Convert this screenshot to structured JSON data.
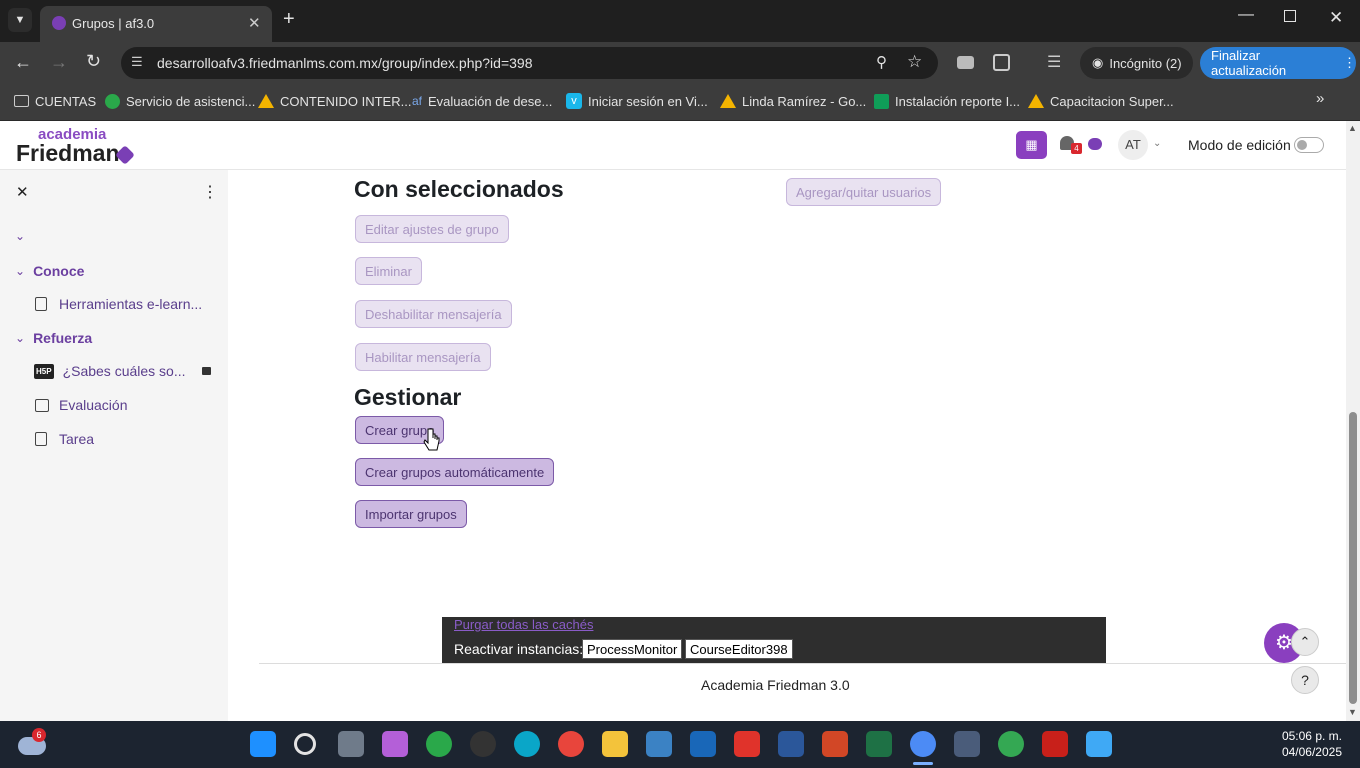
{
  "browser": {
    "tab_title": "Grupos | af3.0",
    "url": "desarrolloafv3.friedmanlms.com.mx/group/index.php?id=398",
    "incognito_label": "Incógnito (2)",
    "update_button": "Finalizar actualización",
    "bookmarks": [
      {
        "label": "CUENTAS",
        "icon": "folder-icon"
      },
      {
        "label": "Servicio de asistenci...",
        "icon": "headset-icon"
      },
      {
        "label": "CONTENIDO INTER...",
        "icon": "drive-icon"
      },
      {
        "label": "Evaluación de dese...",
        "icon": "af-icon"
      },
      {
        "label": "Iniciar sesión en Vi...",
        "icon": "vimeo-icon"
      },
      {
        "label": "Linda Ramírez - Go...",
        "icon": "drive-icon"
      },
      {
        "label": "Instalación reporte I...",
        "icon": "sheets-icon"
      },
      {
        "label": "Capacitacion Super...",
        "icon": "drive-icon"
      }
    ]
  },
  "header": {
    "logo_top": "academia",
    "logo_bottom": "Friedman",
    "notification_count": "4",
    "avatar_initials": "AT",
    "edit_mode_label": "Modo de edición"
  },
  "sidebar": {
    "sections": [
      {
        "title": "Conoce",
        "items": [
          {
            "label": "Herramientas e-learn...",
            "icon": "page-icon"
          }
        ]
      },
      {
        "title": "Refuerza",
        "items": [
          {
            "label": "¿Sabes cuáles so...",
            "icon": "h5p-icon"
          },
          {
            "label": "Evaluación",
            "icon": "quiz-icon"
          },
          {
            "label": "Tarea",
            "icon": "assignment-icon"
          }
        ]
      }
    ],
    "h5p_badge": "H5P"
  },
  "main": {
    "with_selected_title": "Con seleccionados",
    "with_selected_buttons": [
      "Editar ajustes de grupo",
      "Eliminar",
      "Deshabilitar mensajería",
      "Habilitar mensajería"
    ],
    "add_remove_users": "Agregar/quitar usuarios",
    "manage_title": "Gestionar",
    "manage_buttons": [
      "Crear grupo",
      "Crear grupos automáticamente",
      "Importar grupos"
    ]
  },
  "dev": {
    "purge_link": "Purgar todas las cachés",
    "reactivate_label": "Reactivar instancias:",
    "instances": [
      "ProcessMonitor",
      "CourseEditor398"
    ]
  },
  "footer": {
    "site_name": "Academia Friedman 3.0",
    "help": "?"
  },
  "taskbar": {
    "weather_badge": "6",
    "time": "05:06 p. m.",
    "date": "04/06/2025"
  },
  "colors": {
    "brand_purple": "#7a3fb5",
    "button_fill": "#ccb9e1",
    "chrome_dark": "#1f1f1f"
  }
}
